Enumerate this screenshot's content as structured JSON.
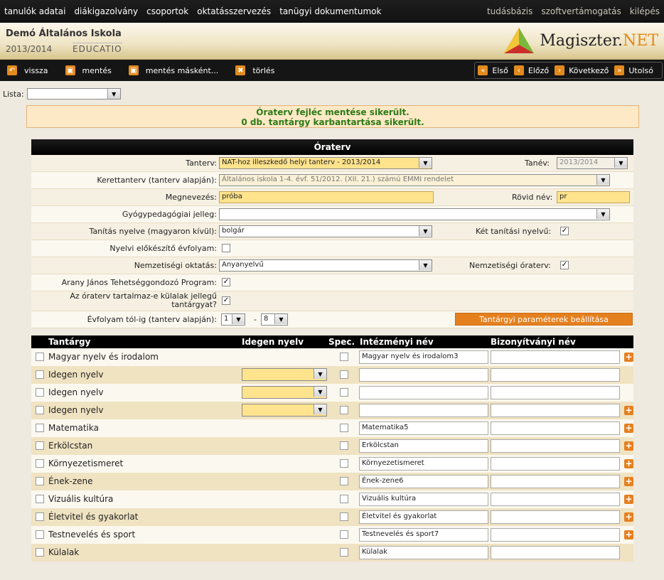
{
  "topnav": {
    "left": [
      "tanulók adatai",
      "diákigazolvány",
      "csoportok",
      "oktatásszervezés",
      "tanügyi dokumentumok"
    ],
    "right": [
      "tudásbázis",
      "szoftvertámogatás",
      "kilépés"
    ]
  },
  "header": {
    "school": "Demó Általános Iskola",
    "year": "2013/2014",
    "org": "EDUCATIO",
    "brand": "Magiszter.",
    "brand_suffix": "NET"
  },
  "toolbar": {
    "back": "vissza",
    "save": "mentés",
    "save_as": "mentés másként...",
    "delete": "törlés",
    "first": "Első",
    "prev": "Előző",
    "next": "Következő",
    "last": "Utolsó"
  },
  "lista": {
    "label": "Lista:",
    "value": ""
  },
  "message": {
    "line1": "Óraterv fejléc mentése sikerült.",
    "line2": "0 db. tantárgy karbantartása sikerült."
  },
  "form": {
    "title": "Óraterv",
    "tanterv_label": "Tanterv:",
    "tanterv_value": "NAT-hoz illeszkedő helyi tanterv - 2013/2014",
    "tanev_label": "Tanév:",
    "tanev_value": "2013/2014",
    "kerettanterv_label": "Kerettanterv (tanterv alapján):",
    "kerettanterv_value": "Általános iskola 1-4. évf. 51/2012. (XII. 21.) számú EMMI rendelet",
    "megnevezes_label": "Megnevezés:",
    "megnevezes_value": "próba",
    "rovid_label": "Rövid név:",
    "rovid_value": "pr",
    "gyogy_label": "Gyógypedagógiai jelleg:",
    "gyogy_value": "",
    "nyelv_label": "Tanítás nyelve (magyaron kívül):",
    "nyelv_value": "bolgár",
    "ket_label": "Két tanítási nyelvű:",
    "ket_checked": true,
    "elokeszito_label": "Nyelvi előkészítő évfolyam:",
    "elokeszito_checked": false,
    "nemzetisegi_label": "Nemzetiségi oktatás:",
    "nemzetisegi_value": "Anyanyelvű",
    "nemzetisegi_oraterv_label": "Nemzetiségi óraterv:",
    "nemzetisegi_oraterv_checked": true,
    "arany_label": "Arany János Tehetséggondozó Program:",
    "arany_checked": true,
    "kulalak_label1": "Az óraterv tartalmaz-e külalak jellegű",
    "kulalak_label2": "tantárgyat?",
    "kulalak_checked": true,
    "evfolyam_label": "Évfolyam tól-ig (tanterv alapján):",
    "evf_from": "1",
    "evf_dash": "-",
    "evf_to": "8",
    "param_button": "Tantárgyi paraméterek beállítása"
  },
  "table": {
    "headers": {
      "subject": "Tantárgy",
      "lang": "Idegen nyelv",
      "spec": "Spec.",
      "inst": "Intézményi név",
      "cert": "Bizonyítványi név"
    },
    "rows": [
      {
        "subject": "Magyar nyelv és irodalom",
        "inst": "Magyar nyelv és irodalom3",
        "cert": "",
        "plus": true,
        "lang": false
      },
      {
        "subject": "Idegen nyelv",
        "inst": "",
        "cert": "",
        "plus": false,
        "lang": true
      },
      {
        "subject": "Idegen nyelv",
        "inst": "",
        "cert": "",
        "plus": false,
        "lang": true
      },
      {
        "subject": "Idegen nyelv",
        "inst": "",
        "cert": "",
        "plus": true,
        "lang": true
      },
      {
        "subject": "Matematika",
        "inst": "Matematika5",
        "cert": "",
        "plus": true,
        "lang": false
      },
      {
        "subject": "Erkölcstan",
        "inst": "Erkölcstan",
        "cert": "",
        "plus": true,
        "lang": false
      },
      {
        "subject": "Környezetismeret",
        "inst": "Környezetismeret",
        "cert": "",
        "plus": true,
        "lang": false
      },
      {
        "subject": "Ének-zene",
        "inst": "Ének-zene6",
        "cert": "",
        "plus": true,
        "lang": false
      },
      {
        "subject": "Vizuális kultúra",
        "inst": "Vizuális kultúra",
        "cert": "",
        "plus": true,
        "lang": false
      },
      {
        "subject": "Életvitel és gyakorlat",
        "inst": "Életvitel és gyakorlat",
        "cert": "",
        "plus": true,
        "lang": false
      },
      {
        "subject": "Testnevelés és sport",
        "inst": "Testnevelés és sport7",
        "cert": "",
        "plus": true,
        "lang": false
      },
      {
        "subject": "Külalak",
        "inst": "Külalak",
        "cert": "",
        "plus": false,
        "lang": false
      }
    ]
  },
  "colors": {
    "accent": "#e5801f",
    "message_green": "#2c7a15",
    "highlight": "#ffe38d"
  }
}
